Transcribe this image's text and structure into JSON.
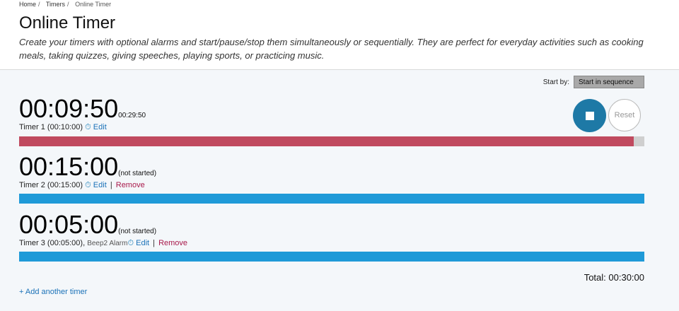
{
  "breadcrumb": {
    "home": "Home",
    "timers": "Timers",
    "current": "Online Timer",
    "separator": "/"
  },
  "page": {
    "title": "Online Timer",
    "description": "Create your timers with optional alarms and start/pause/stop them simultaneously or sequentially. They are perfect for everyday activities such as cooking meals, taking quizzes, giving speeches, playing sports, or practicing music."
  },
  "controls": {
    "start_by_label": "Start by:",
    "start_by_value": "Start in sequence",
    "reset_label": "Reset",
    "stop_icon": "stop-icon"
  },
  "timers": [
    {
      "display": "00:09:50",
      "sub": "00:29:50",
      "name": "Timer 1 (00:10:00)",
      "alarm": "",
      "edit": "Edit",
      "remove": "",
      "progress": 0.983,
      "bar_color": "#c04a5f",
      "track_color": "#cfcfcf"
    },
    {
      "display": "00:15:00",
      "sub": "(not started)",
      "name": "Timer 2 (00:15:00)",
      "alarm": "",
      "edit": "Edit",
      "remove": "Remove",
      "progress": 1.0,
      "bar_color": "#1f9ad8",
      "track_color": "#1f9ad8"
    },
    {
      "display": "00:05:00",
      "sub": "(not started)",
      "name": "Timer 3 (00:05:00),",
      "alarm": "Beep2 Alarm",
      "edit": "Edit",
      "remove": "Remove",
      "progress": 1.0,
      "bar_color": "#1f9ad8",
      "track_color": "#1f9ad8"
    }
  ],
  "footer": {
    "total": "Total: 00:30:00",
    "add_timer": "+ Add another timer"
  },
  "icons": {
    "timer_edit": "stopwatch-icon",
    "clock_glyph": "⏱"
  }
}
